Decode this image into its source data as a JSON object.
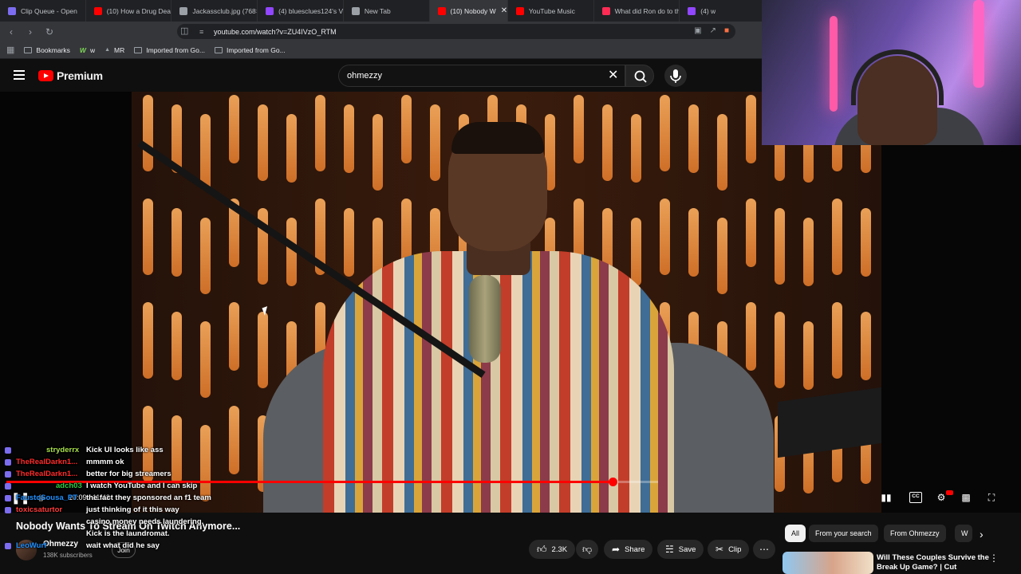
{
  "browser": {
    "tabs": [
      {
        "label": "Clip Queue - Open",
        "color": "#7c6cf0"
      },
      {
        "label": "(10) How a Drug Deal",
        "color": "#ff0000"
      },
      {
        "label": "Jackassclub.jpg (768×",
        "color": "#9aa0a6"
      },
      {
        "label": "(4) bluesclues124's Vid",
        "color": "#9146ff"
      },
      {
        "label": "New Tab",
        "color": "#9aa0a6"
      },
      {
        "label": "(10) Nobody W",
        "color": "#ff0000",
        "active": true
      },
      {
        "label": "YouTube Music",
        "color": "#ff0000"
      },
      {
        "label": "What did Ron do to th",
        "color": "#fe2c55"
      },
      {
        "label": "(4) w",
        "color": "#9146ff"
      }
    ],
    "url": "youtube.com/watch?v=ZU4IVzO_RTM",
    "bookmarks": [
      {
        "label": "Bookmarks"
      },
      {
        "label": "w"
      },
      {
        "label": "MR"
      },
      {
        "label": "Imported from Go..."
      },
      {
        "label": "Imported from Go..."
      }
    ]
  },
  "youtube": {
    "logo_text": "Premium",
    "search_value": "ohmezzy",
    "player": {
      "progress": 0.93,
      "time": "10:09 / 11:43"
    },
    "video": {
      "title": "Nobody Wants To Stream On Twitch Anymore...",
      "channel": "Ohmezzy",
      "subscribers": "138K subscribers",
      "join_label": "Join",
      "likes": "2.3K",
      "share_label": "Share",
      "save_label": "Save",
      "clip_label": "Clip"
    },
    "chips": [
      "All",
      "From your search",
      "From Ohmezzy",
      "W"
    ],
    "recommended": {
      "title": "Will These Couples Survive the Break Up Game? | Cut"
    }
  },
  "chat": [
    {
      "user": "stryderrx",
      "color": "#a7e04a",
      "text": "Kick UI looks like ass"
    },
    {
      "user": "TheRealDarkn1...",
      "color": "#ff2a2a",
      "text": "mmmm ok"
    },
    {
      "user": "TheRealDarkn1...",
      "color": "#ff2a2a",
      "text": "better for big streamers"
    },
    {
      "user": "adch03",
      "color": "#2ecc40",
      "text": "I watch YouTube and I can skip"
    },
    {
      "user": "FaustoSousa_PT",
      "color": "#1e90ff",
      "text": "the fact they sponsored an f1 team"
    },
    {
      "user": "toxicsaturtor",
      "color": "#ff3b3b",
      "text": "just thinking of it this way"
    },
    {
      "user": "",
      "color": "#ffffff",
      "text": "casino money needs laundering."
    },
    {
      "user": "",
      "color": "#ffffff",
      "text": "Kick is the laundromat."
    },
    {
      "user": "LeoWurf",
      "color": "#1e90ff",
      "text": "wait what did he say"
    }
  ]
}
